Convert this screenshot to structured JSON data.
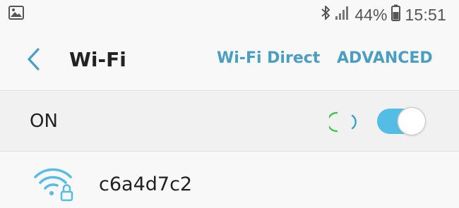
{
  "status_bar": {
    "notification_icon": "image-icon",
    "bluetooth_icon": "bluetooth-icon",
    "signal_icon": "signal-icon",
    "battery_percent": "44%",
    "battery_icon": "battery-icon",
    "time": "15:51"
  },
  "header": {
    "back_icon": "chevron-left-icon",
    "title": "Wi-Fi",
    "wifi_direct_label": "Wi-Fi Direct",
    "advanced_label": "ADVANCED"
  },
  "wifi_switch": {
    "label": "ON",
    "state": true,
    "spinner_icon": "loading-spinner-icon"
  },
  "networks": [
    {
      "name": "c6a4d7c2",
      "icon": "wifi-locked-icon"
    }
  ],
  "colors": {
    "accent": "#4a9ec4",
    "toggle_on": "#54bde6",
    "spinner_green": "#3cc84b",
    "spinner_blue": "#3a9fd6"
  }
}
